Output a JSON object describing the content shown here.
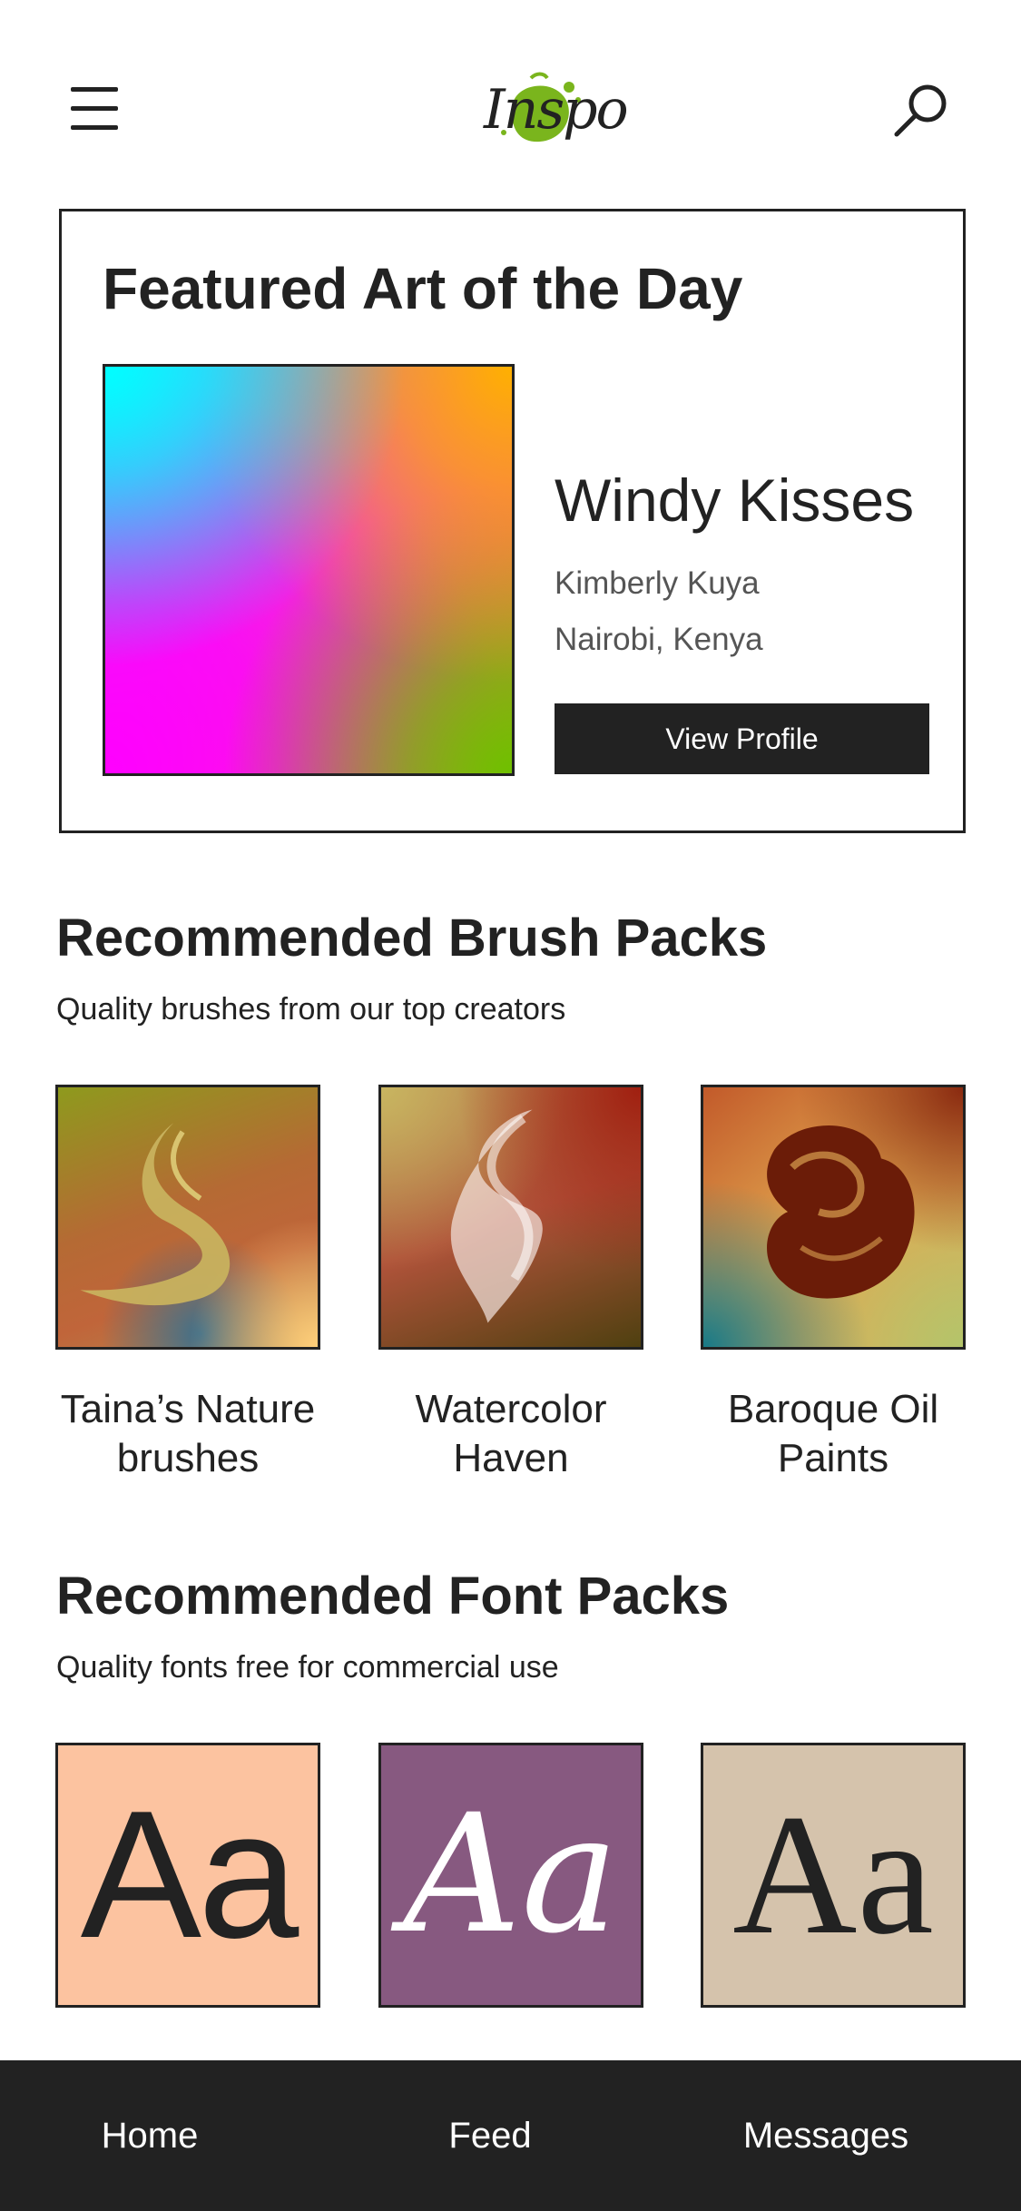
{
  "header": {
    "logo_text": "Inspo",
    "menu_icon": "hamburger-menu-icon",
    "search_icon": "search-icon",
    "logo_accent_color": "#7ab51d"
  },
  "featured": {
    "title": "Featured Art of the Day",
    "art_title": "Windy Kisses",
    "artist_name": "Kimberly Kuya",
    "location": "Nairobi, Kenya",
    "button_label": "View Profile"
  },
  "brush_section": {
    "title": "Recommended Brush Packs",
    "subtitle": "Quality brushes from our top creators",
    "packs": [
      {
        "label": "Taina’s Nature brushes"
      },
      {
        "label": "Watercolor Haven"
      },
      {
        "label": "Baroque Oil Paints"
      }
    ]
  },
  "font_section": {
    "title": "Recommended Font Packs",
    "subtitle": "Quality fonts free for commercial use",
    "tiles": [
      {
        "sample": "Aa",
        "bg": "#fcc3a0"
      },
      {
        "sample": "Aa",
        "bg": "#875980"
      },
      {
        "sample": "Aa",
        "bg": "#d5c3ac"
      }
    ]
  },
  "bottom_nav": {
    "items": [
      {
        "label": "Home"
      },
      {
        "label": "Feed"
      },
      {
        "label": "Messages"
      }
    ]
  },
  "colors": {
    "dark": "#222222",
    "white": "#ffffff"
  }
}
